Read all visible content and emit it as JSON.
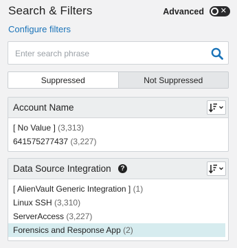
{
  "header": {
    "title": "Search & Filters",
    "advanced_label": "Advanced",
    "advanced_toggle": "off"
  },
  "configure_link": "Configure filters",
  "search": {
    "placeholder": "Enter search phrase",
    "value": ""
  },
  "segmented": {
    "left": "Suppressed",
    "right": "Not Suppressed",
    "selected": "Not Suppressed"
  },
  "panels": [
    {
      "title": "Account Name",
      "items": [
        {
          "label": "[ No Value ]",
          "count": "(3,313)"
        },
        {
          "label": "641575277437",
          "count": "(3,227)"
        }
      ]
    },
    {
      "title": "Data Source Integration",
      "items": [
        {
          "label": "[ AlienVault Generic Integration ]",
          "count": "(1)"
        },
        {
          "label": "Linux SSH",
          "count": "(3,310)"
        },
        {
          "label": "ServerAccess",
          "count": "(3,227)"
        },
        {
          "label": "Forensics and Response App",
          "count": "(2)",
          "selected": true
        }
      ]
    }
  ],
  "colors": {
    "link": "#1a73b8",
    "selected_row": "#d6ecef",
    "search_icon": "#1a73b8"
  }
}
